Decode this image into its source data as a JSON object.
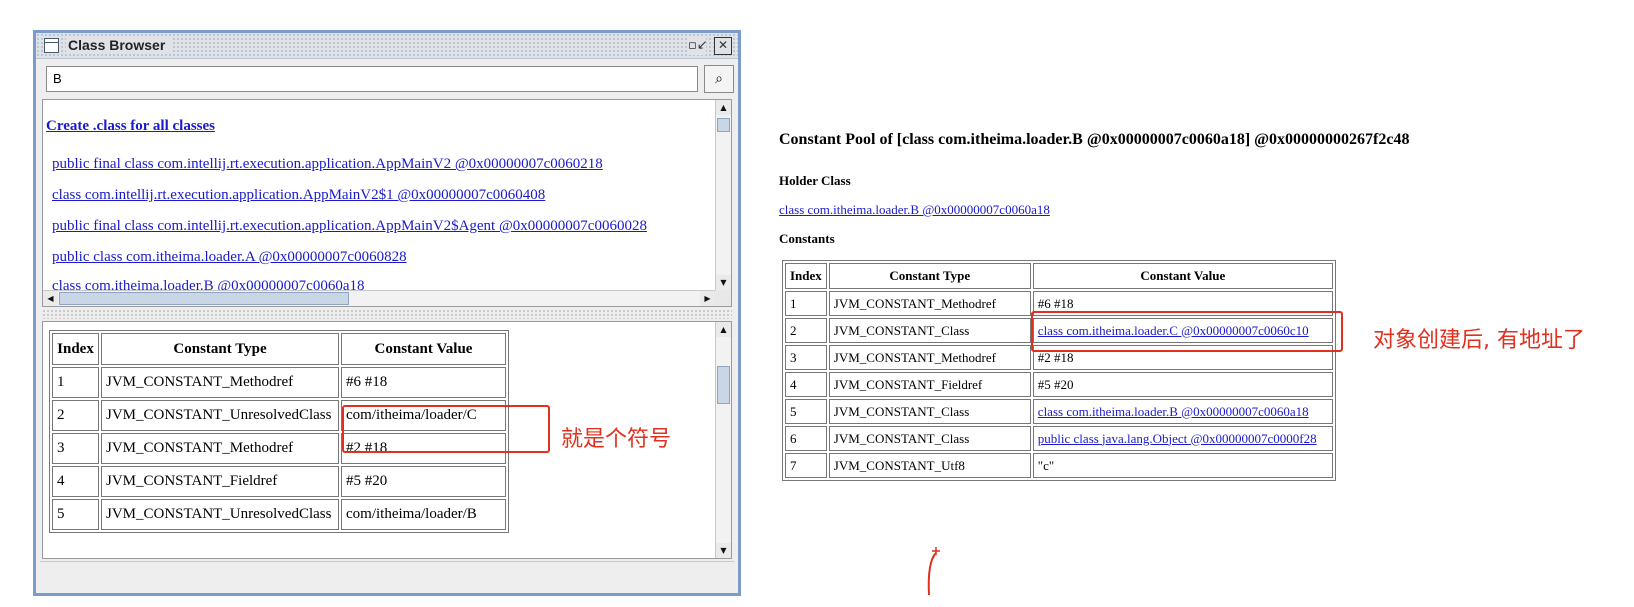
{
  "window": {
    "title": "Class Browser",
    "minimize_glyph": "▫↙",
    "close_glyph": "✕",
    "search_value": "B",
    "search_icon": "binoculars-icon",
    "search_glyph": "⌕"
  },
  "class_list": {
    "create_link": "Create .class for all classes",
    "items": [
      "public final class com.intellij.rt.execution.application.AppMainV2 @0x00000007c0060218",
      "class com.intellij.rt.execution.application.AppMainV2$1 @0x00000007c0060408",
      "public final class com.intellij.rt.execution.application.AppMainV2$Agent @0x00000007c0060028",
      "public class com.itheima.loader.A @0x00000007c0060828",
      "class com.itheima.loader.B @0x00000007c0060a18"
    ]
  },
  "left_table": {
    "headers": [
      "Index",
      "Constant Type",
      "Constant Value"
    ],
    "rows": [
      [
        "1",
        "JVM_CONSTANT_Methodref",
        "#6 #18"
      ],
      [
        "2",
        "JVM_CONSTANT_UnresolvedClass",
        "com/itheima/loader/C"
      ],
      [
        "3",
        "JVM_CONSTANT_Methodref",
        "#2 #18"
      ],
      [
        "4",
        "JVM_CONSTANT_Fieldref",
        "#5 #20"
      ],
      [
        "5",
        "JVM_CONSTANT_UnresolvedClass",
        "com/itheima/loader/B"
      ]
    ]
  },
  "right_page": {
    "title": "Constant Pool of [class com.itheima.loader.B @0x00000007c0060a18] @0x00000000267f2c48",
    "holder_label": "Holder Class",
    "holder_link": "class com.itheima.loader.B @0x00000007c0060a18",
    "constants_label": "Constants",
    "headers": [
      "Index",
      "Constant Type",
      "Constant Value"
    ],
    "rows": [
      [
        "1",
        "JVM_CONSTANT_Methodref",
        "#6 #18"
      ],
      [
        "2",
        "JVM_CONSTANT_Class",
        "class com.itheima.loader.C @0x00000007c0060c10"
      ],
      [
        "3",
        "JVM_CONSTANT_Methodref",
        "#2 #18"
      ],
      [
        "4",
        "JVM_CONSTANT_Fieldref",
        "#5 #20"
      ],
      [
        "5",
        "JVM_CONSTANT_Class",
        "class com.itheima.loader.B @0x00000007c0060a18"
      ],
      [
        "6",
        "JVM_CONSTANT_Class",
        "public class java.lang.Object @0x00000007c0000f28"
      ],
      [
        "7",
        "JVM_CONSTANT_Utf8",
        "\"c\""
      ]
    ],
    "link_rows": [
      2,
      5,
      6
    ]
  },
  "annotations": {
    "left_note": "就是个符号",
    "right_note": "对象创建后, 有地址了",
    "color": "#e0301e"
  }
}
